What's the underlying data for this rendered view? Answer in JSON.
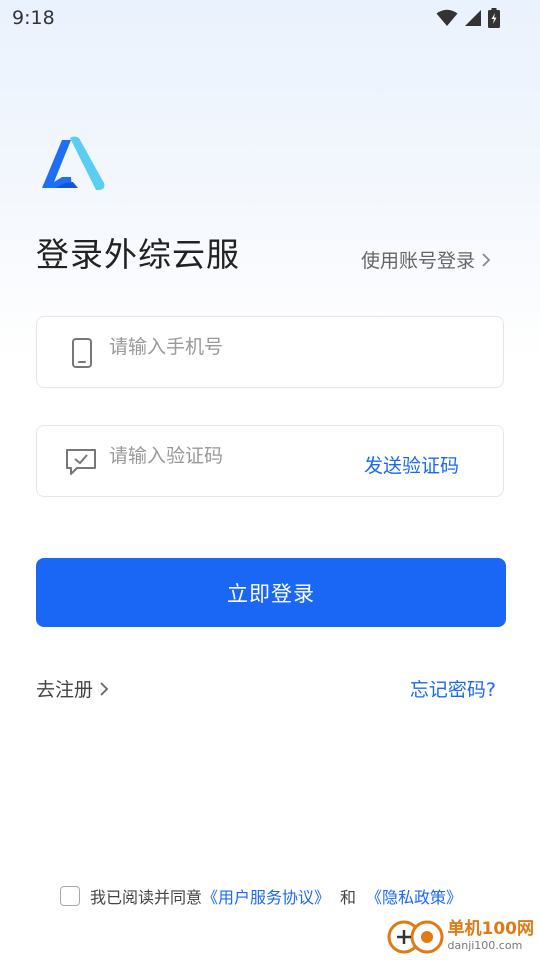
{
  "status_bar": {
    "time": "9:18"
  },
  "header": {
    "title": "登录外综云服",
    "account_login": "使用账号登录"
  },
  "form": {
    "phone_placeholder": "请输入手机号",
    "code_placeholder": "请输入验证码",
    "send_code": "发送验证码",
    "login_button": "立即登录"
  },
  "links": {
    "register": "去注册",
    "forgot": "忘记密码?"
  },
  "agreement": {
    "prefix": "我已阅读并同意",
    "user_agreement": "《用户服务协议》",
    "and": "和",
    "privacy_policy": "《隐私政策》"
  },
  "watermark": {
    "brand": "单机100网",
    "domain": "danji100.com"
  },
  "colors": {
    "primary": "#1a66f5",
    "logo_dark": "#1f6ff5",
    "logo_light": "#5ccdf2",
    "watermark": "#e07a12"
  },
  "icons": {
    "wifi": "wifi-icon",
    "signal": "signal-icon",
    "battery": "battery-charging-icon",
    "phone": "phone-icon",
    "message": "message-check-icon",
    "chevron": "chevron-right-icon"
  }
}
